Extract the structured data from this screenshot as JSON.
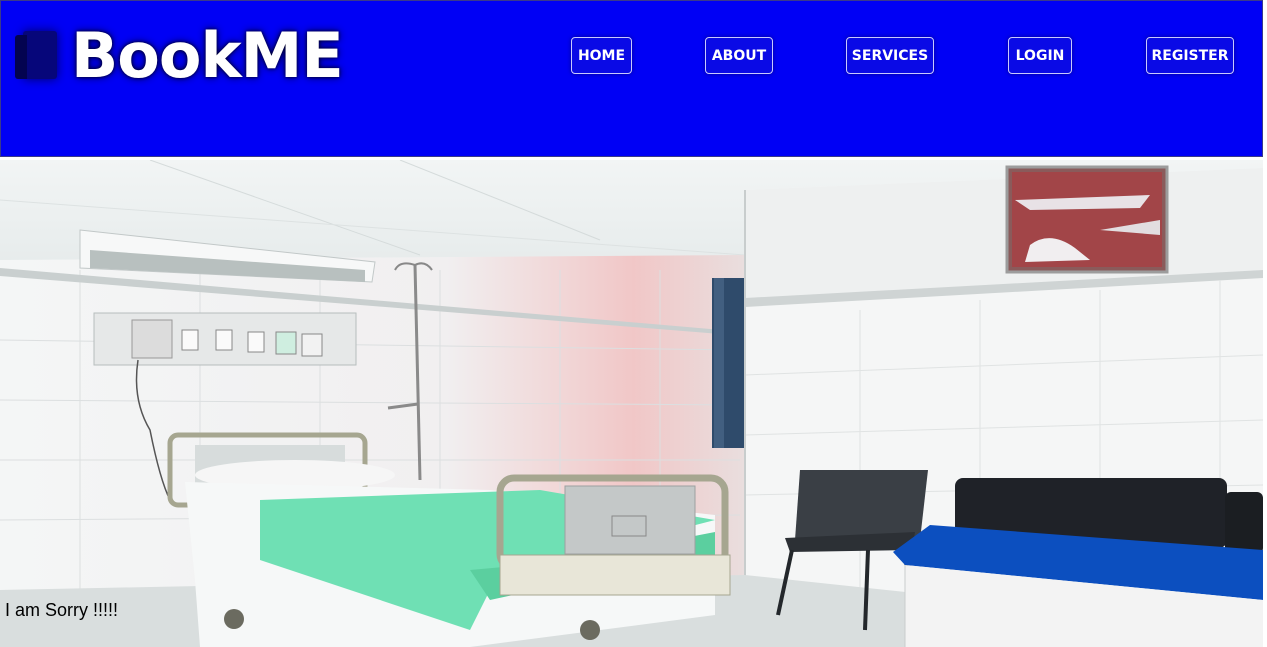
{
  "brand": {
    "name": "BookME",
    "icon": "book-icon"
  },
  "nav": {
    "home": "HOME",
    "about": "ABOUT",
    "services": "SERVICES",
    "login": "LOGIN",
    "register": "REGISTER"
  },
  "message": "I am Sorry !!!!!",
  "colors": {
    "header_bg": "#0000f5",
    "text": "#ffffff"
  }
}
